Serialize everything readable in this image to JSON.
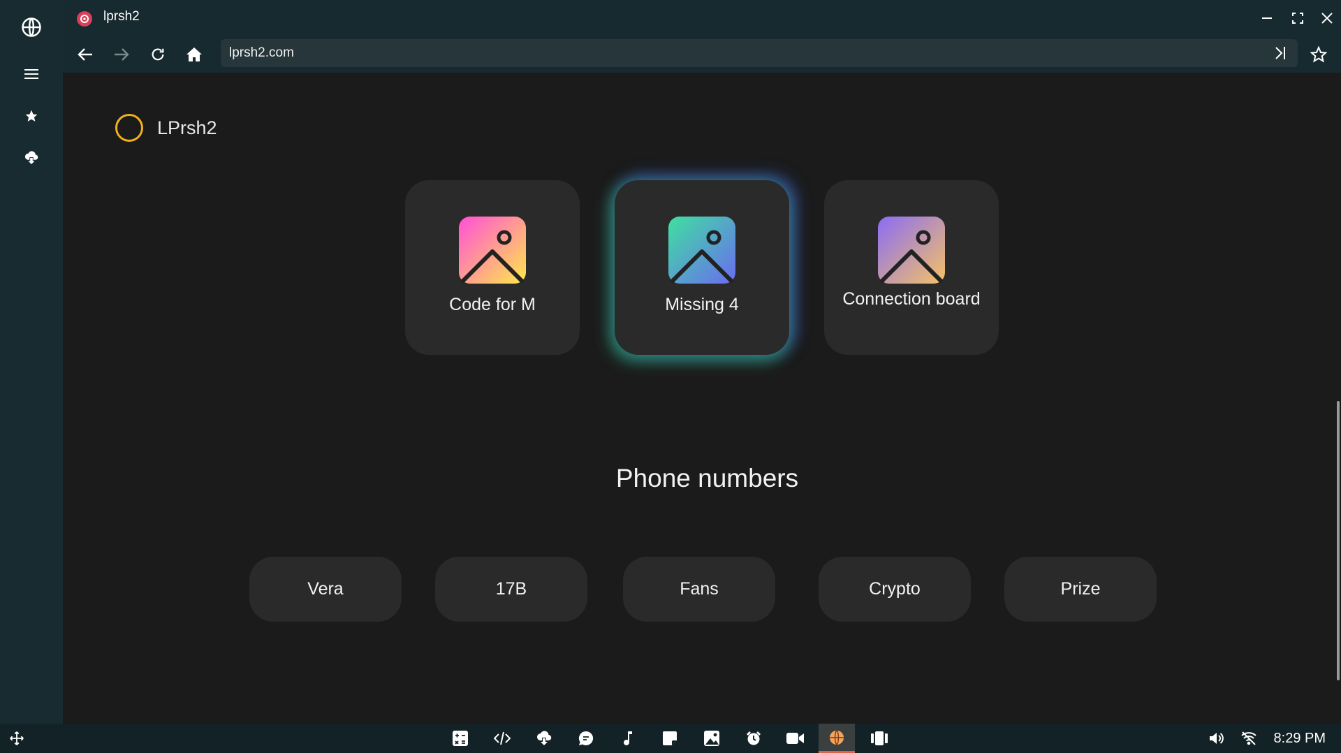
{
  "window": {
    "tab_title": "lprsh2",
    "url": "lprsh2.com"
  },
  "rail": {
    "icons": [
      "globe-icon",
      "menu-icon",
      "star-icon",
      "cloud-download-icon"
    ]
  },
  "page": {
    "brand": "LPrsh2",
    "cards": [
      {
        "label": "Code for M",
        "icon": "image-icon",
        "gradient": [
          "#ff4fd8",
          "#ffe94a"
        ]
      },
      {
        "label": "Missing 4",
        "icon": "image-icon",
        "gradient": [
          "#3fe0a0",
          "#6a6cf0"
        ]
      },
      {
        "label": "Connection board",
        "icon": "image-icon",
        "gradient": [
          "#8a6cf5",
          "#f5c266"
        ]
      }
    ],
    "section_title": "Phone numbers",
    "pills": [
      "Vera",
      "17B",
      "Fans",
      "Crypto",
      "Prize"
    ]
  },
  "taskbar": {
    "apps": [
      "calculator-icon",
      "code-icon",
      "cloud-download-icon",
      "chat-icon",
      "music-icon",
      "sticky-note-icon",
      "photos-icon",
      "alarm-icon",
      "video-icon",
      "browser-icon",
      "panels-icon"
    ],
    "active_app": "browser-icon",
    "time": "8:29 PM"
  },
  "colors": {
    "accent_ring": "#f2b01e",
    "active_indicator": "#e0614a"
  }
}
